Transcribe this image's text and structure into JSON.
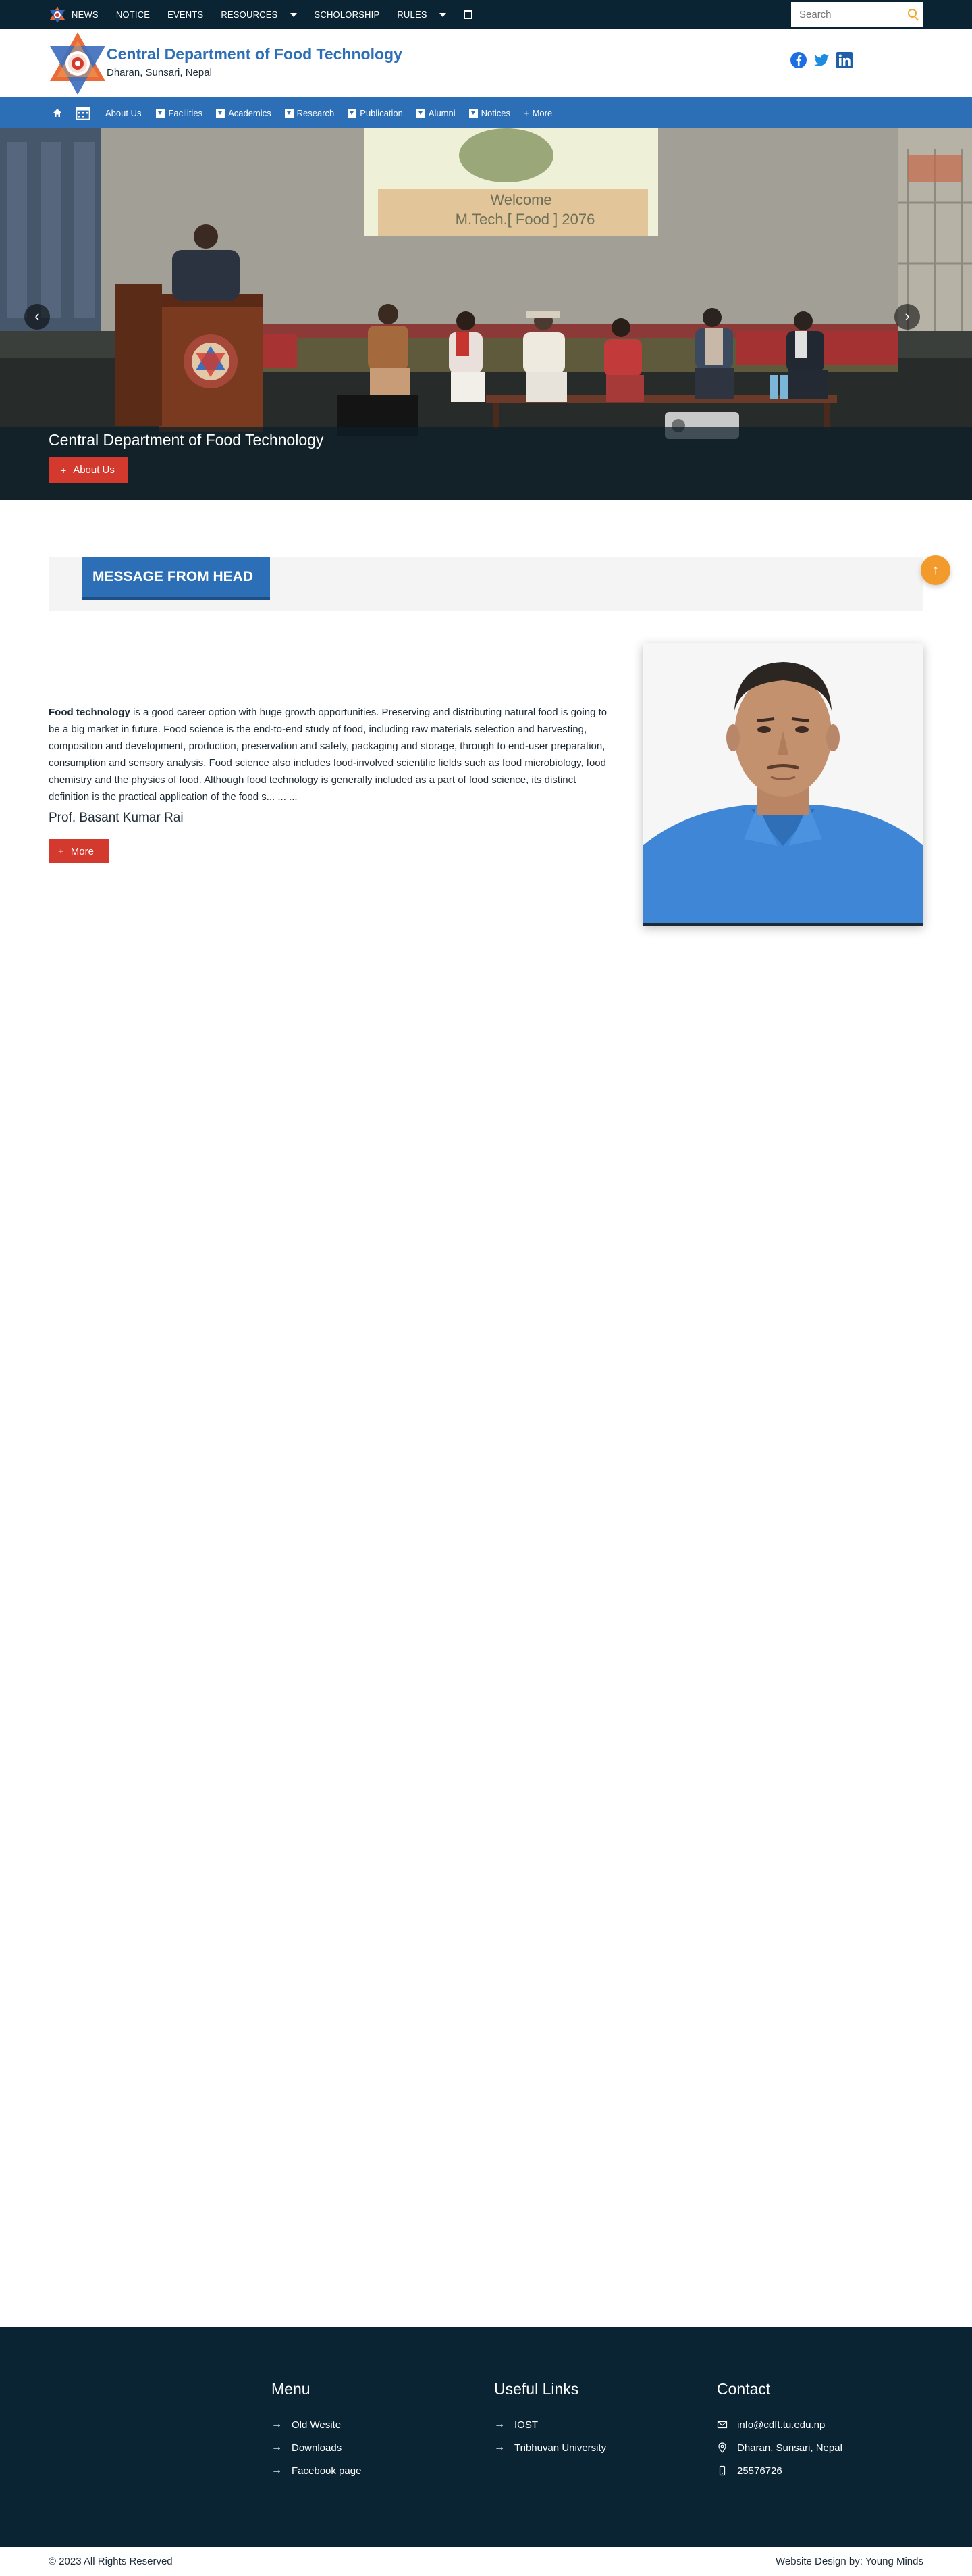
{
  "topbar": {
    "items": [
      {
        "label": "NEWS"
      },
      {
        "label": "NOTICE"
      },
      {
        "label": "EVENTS"
      },
      {
        "label": "RESOURCES"
      },
      {
        "label": "SCHOLORSHIP"
      },
      {
        "label": "RULES"
      }
    ],
    "search_placeholder": "Search"
  },
  "header": {
    "title": "Central Department of Food Technology",
    "subtitle": "Dharan, Sunsari, Nepal"
  },
  "nav": {
    "items": [
      "About Us",
      "Facilities",
      "Academics",
      "Research",
      "Publication",
      "Alumni",
      "Notices",
      "More"
    ]
  },
  "hero": {
    "slide_text": "Welcome\nM.Tech.[ Food ] 2076",
    "screen_line1": "Welcome",
    "screen_line2": "M.Tech.[ Food ] 2076",
    "caption_title": "Central Department of Food Technology",
    "caption_button": "About Us",
    "prev": "‹",
    "next": "›"
  },
  "message": {
    "heading": "MESSAGE FROM HEAD",
    "lead": "Food technology",
    "body": " is a good career option with huge growth opportunities. Preserving and distributing natural food is going to be a big market in future. Food science is the end-to-end study of food, including raw materials selection and harvesting, composition and development, production, preservation and safety, packaging and storage, through to end-user preparation, consumption and sensory analysis. Food science also includes food-involved scientific fields such as food microbiology, food chemistry and the physics of food. Although food technology is generally included as a part of food science, its distinct definition is the practical application of the food s... ... ...",
    "author": "Prof. Basant Kumar Rai",
    "more_label": "More"
  },
  "footer": {
    "menu": {
      "title": "Menu",
      "items": [
        "Old Wesite",
        "Downloads",
        "Facebook page"
      ]
    },
    "links": {
      "title": "Useful Links",
      "items": [
        "IOST",
        "Tribhuvan University"
      ]
    },
    "contact": {
      "title": "Contact",
      "email": "info@cdft.tu.edu.np",
      "address": "Dharan, Sunsari, Nepal",
      "phone": "25576726"
    },
    "copyright": "© 2023 All Rights Reserved",
    "credit": "Website Design by: Young Minds"
  },
  "colors": {
    "topbar": "#0a2433",
    "brand_blue": "#2c6fb7",
    "accent_red": "#d3392c",
    "scroll_orange": "#f39a2c"
  },
  "icons": [
    "tu-logo-icon",
    "calendar-icon",
    "search-icon",
    "facebook-icon",
    "twitter-icon",
    "linkedin-icon",
    "home-icon",
    "arrow-right-icon",
    "mail-icon",
    "location-icon",
    "phone-icon",
    "arrow-up-icon"
  ]
}
